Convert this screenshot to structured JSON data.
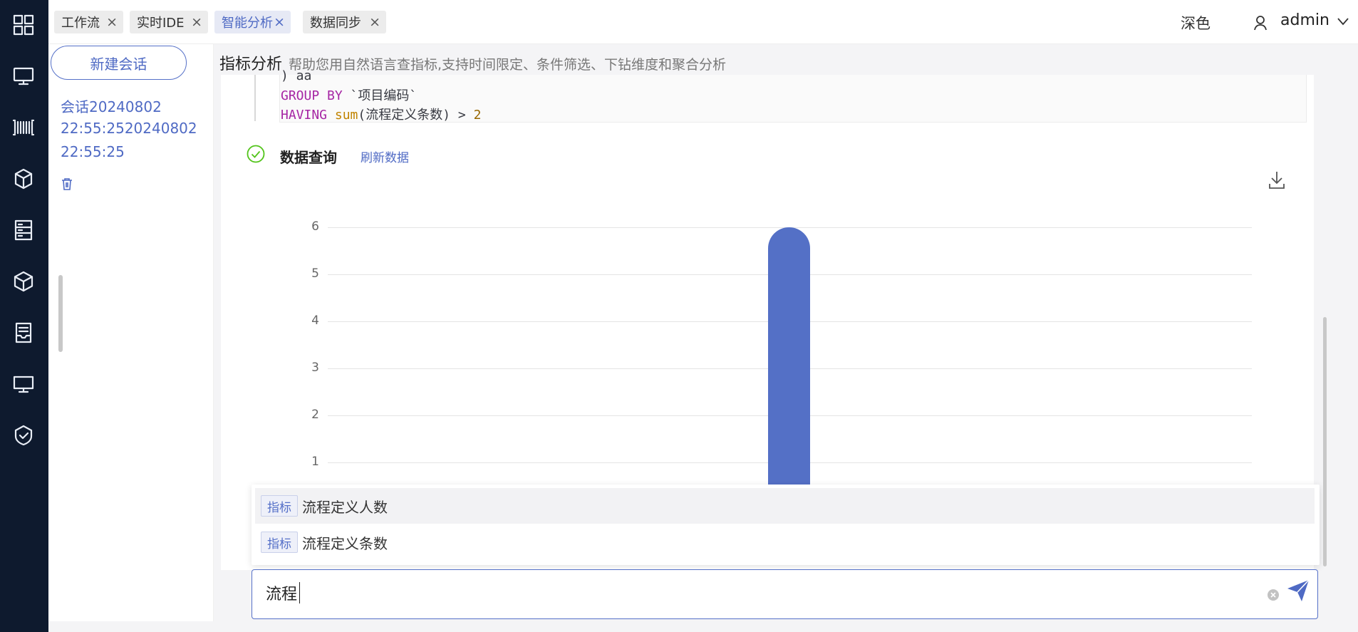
{
  "tabs": [
    {
      "label": "工作流"
    },
    {
      "label": "实时IDE"
    },
    {
      "label": "智能分析",
      "active": true
    },
    {
      "label": "数据同步"
    }
  ],
  "header": {
    "theme_label": "深色",
    "user": "admin"
  },
  "sidebar": {
    "new_button": "新建会话",
    "session_lines": [
      "会话20240802",
      "22:55:2520240802",
      "22:55:25"
    ]
  },
  "main": {
    "title": "指标分析",
    "subtitle": "帮助您用自然语言查指标,支持时间限定、条件筛选、下钻维度和聚合分析",
    "sql_line1": ") aa",
    "sql_line2_kw": "GROUP BY",
    "sql_line2_rest": " `项目编码`",
    "sql_line3_kw": "HAVING",
    "sql_line3_fn": "sum",
    "sql_line3_arg": "(流程定义条数) > ",
    "sql_line3_num": "2",
    "step_title": "数据查询",
    "refresh_link": "刷新数据"
  },
  "chart_data": {
    "type": "bar",
    "title": "",
    "xlabel": "",
    "ylabel": "",
    "ylim": [
      0,
      6
    ],
    "yticks": [
      "6",
      "5",
      "4",
      "3",
      "2",
      "1"
    ],
    "series": [
      {
        "values": [
          6
        ]
      }
    ],
    "bar_color": "#5470c6",
    "grid": true
  },
  "suggestions": [
    {
      "tag": "指标",
      "label": "流程定义人数"
    },
    {
      "tag": "指标",
      "label": "流程定义条数"
    }
  ],
  "input": {
    "value": "流程"
  },
  "colors": {
    "accent": "#4f6ac4",
    "rail": "#0e1a2e",
    "success": "#52c41a"
  }
}
